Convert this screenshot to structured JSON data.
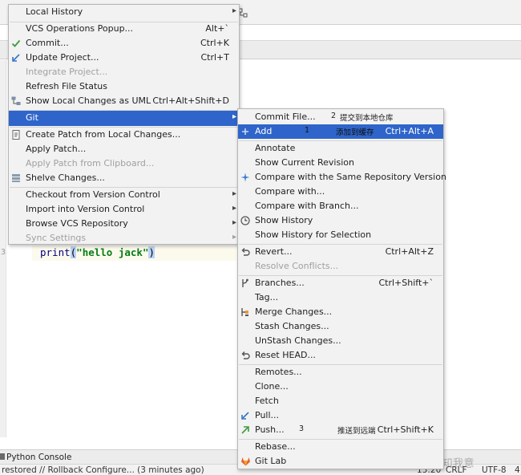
{
  "editor": {
    "line_number": "3",
    "code": {
      "keyword": "print",
      "open": "(",
      "string": "\"hello jack\"",
      "close": ")"
    }
  },
  "console_tab": "Python Console",
  "status": {
    "message": "restored // Rollback Configure... (3 minutes ago)",
    "position": "13:20",
    "line_sep": "CRLF",
    "encoding": "UTF-8",
    "indent": "4"
  },
  "watermark": "CSDN @南风知我意",
  "main_menu": {
    "local_history": "Local History",
    "vcs_operations": "VCS Operations Popup...",
    "vcs_operations_shortcut": "Alt+`",
    "commit": "Commit...",
    "commit_shortcut": "Ctrl+K",
    "update_project": "Update Project...",
    "update_project_shortcut": "Ctrl+T",
    "integrate_project": "Integrate Project...",
    "refresh_file_status": "Refresh File Status",
    "show_local_changes": "Show Local Changes as UML",
    "show_local_changes_shortcut": "Ctrl+Alt+Shift+D",
    "git": "Git",
    "create_patch": "Create Patch from Local Changes...",
    "apply_patch": "Apply Patch...",
    "apply_patch_clipboard": "Apply Patch from Clipboard...",
    "shelve_changes": "Shelve Changes...",
    "checkout_vcs": "Checkout from Version Control",
    "import_vcs": "Import into Version Control",
    "browse_vcs": "Browse VCS Repository",
    "sync_settings": "Sync Settings"
  },
  "git_menu": {
    "commit_file": "Commit File...",
    "commit_file_note_num": "2",
    "commit_file_note": "提交到本地仓库",
    "add": "Add",
    "add_note_num": "1",
    "add_note": "添加到缓存",
    "add_shortcut": "Ctrl+Alt+A",
    "annotate": "Annotate",
    "show_current_revision": "Show Current Revision",
    "compare_same_repo": "Compare with the Same Repository Version",
    "compare_with": "Compare with...",
    "compare_branch": "Compare with Branch...",
    "show_history": "Show History",
    "show_history_selection": "Show History for Selection",
    "revert": "Revert...",
    "revert_shortcut": "Ctrl+Alt+Z",
    "resolve_conflicts": "Resolve Conflicts...",
    "branches": "Branches...",
    "branches_shortcut": "Ctrl+Shift+`",
    "tag": "Tag...",
    "merge_changes": "Merge Changes...",
    "stash_changes": "Stash Changes...",
    "unstash_changes": "UnStash Changes...",
    "reset_head": "Reset HEAD...",
    "remotes": "Remotes...",
    "clone": "Clone...",
    "fetch": "Fetch",
    "pull": "Pull...",
    "push": "Push...",
    "push_note_num": "3",
    "push_note": "推送到远端",
    "push_shortcut": "Ctrl+Shift+K",
    "rebase": "Rebase...",
    "gitlab": "Git Lab"
  },
  "colors": {
    "selection": "#2f65ca",
    "menu_bg": "#f2f2f2",
    "check_green": "#3d9a3d",
    "arrow_blue": "#3574c4",
    "gitlab_orange": "#e2632b"
  }
}
